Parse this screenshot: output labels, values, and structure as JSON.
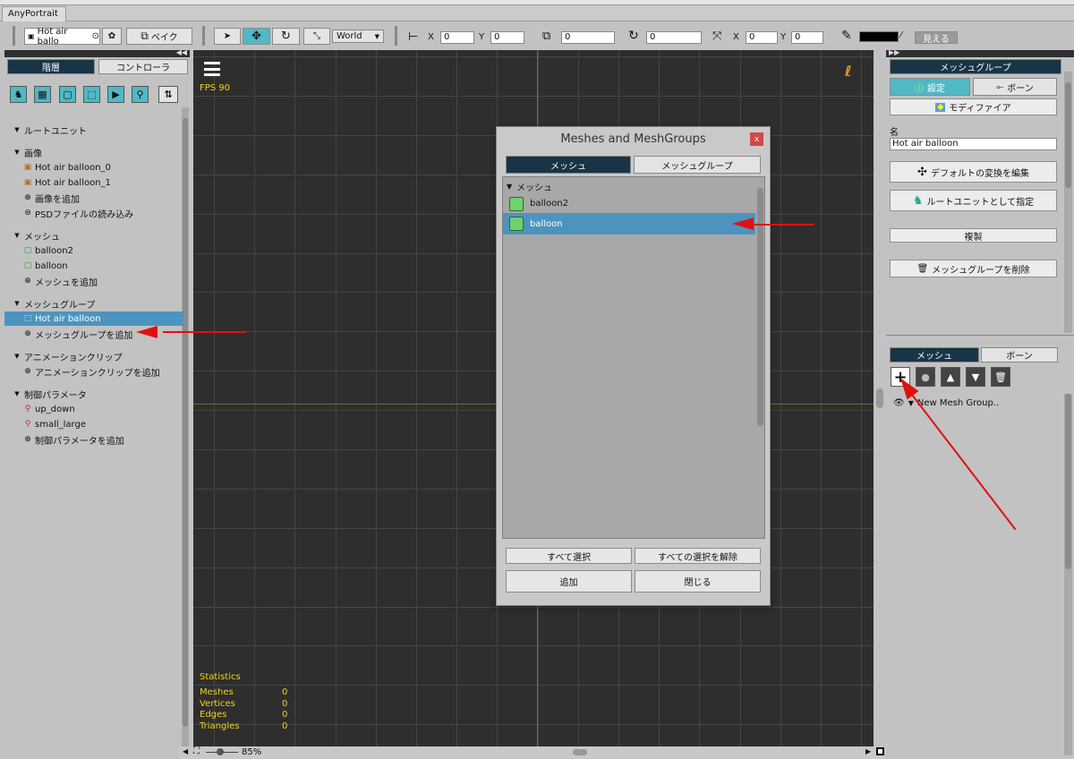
{
  "app": {
    "tab_label": "AnyPortrait"
  },
  "toolbar": {
    "portrait_selector": "Hot air ballo",
    "bake_label": "ベイク",
    "space_select": "World",
    "pos_x_label": "X",
    "pos_x_value": "0",
    "pos_y_label": "Y",
    "pos_y_value": "0",
    "depth_value": "0",
    "rotation_value": "0",
    "scale_x_label": "X",
    "scale_x_value": "0",
    "scale_y_label": "Y",
    "scale_y_value": "0",
    "visible_label": "見える",
    "color_swatch": "#000000"
  },
  "left_panel": {
    "tab_hierarchy": "階層",
    "tab_controller": "コントローラ",
    "sections": [
      {
        "title": "ルートユニット",
        "items": []
      },
      {
        "title": "画像",
        "items": [
          "Hot air balloon_0",
          "Hot air balloon_1",
          "画像を追加",
          "PSDファイルの読み込み"
        ]
      },
      {
        "title": "メッシュ",
        "items": [
          "balloon2",
          "balloon",
          "メッシュを追加"
        ]
      },
      {
        "title": "メッシュグループ",
        "items": [
          "Hot air balloon",
          "メッシュグループを追加"
        ]
      },
      {
        "title": "アニメーションクリップ",
        "items": [
          "アニメーションクリップを追加"
        ]
      },
      {
        "title": "制御パラメータ",
        "items": [
          "up_down",
          "small_large",
          "制御パラメータを追加"
        ]
      }
    ],
    "selected_item": "Hot air balloon"
  },
  "viewport": {
    "fps": "FPS 90",
    "stats_title": "Statistics",
    "stats": [
      {
        "label": "Meshes",
        "value": "0"
      },
      {
        "label": "Vertices",
        "value": "0"
      },
      {
        "label": "Edges",
        "value": "0"
      },
      {
        "label": "Triangles",
        "value": "0"
      }
    ],
    "zoom": "85%"
  },
  "dialog": {
    "title": "Meshes and MeshGroups",
    "close": "x",
    "tab_mesh": "メッシュ",
    "tab_meshgroup": "メッシュグループ",
    "group_header": "メッシュ",
    "items": [
      "balloon2",
      "balloon"
    ],
    "selected": "balloon",
    "select_all": "すべて選択",
    "deselect_all": "すべての選択を解除",
    "add": "追加",
    "close_btn": "閉じる"
  },
  "right_panel": {
    "header": "メッシュグループ",
    "tab_settings": "設定",
    "tab_bone": "ボーン",
    "modifier_btn": "モディファイア",
    "name_label": "名",
    "name_value": "Hot air balloon",
    "edit_default_transform": "デフォルトの変換を編集",
    "set_root_unit": "ルートユニットとして指定",
    "duplicate": "複製",
    "delete_group": "メッシュグループを削除",
    "bottom_tab_mesh": "メッシュ",
    "bottom_tab_bone": "ボーン",
    "tree_item": "New Mesh Group.."
  },
  "colors": {
    "accent": "#4fb9c6",
    "selected_dark": "#193447",
    "selection_blue": "#4c94bf",
    "arrow_red": "#e01010",
    "viewport_text": "#f2d21b"
  }
}
